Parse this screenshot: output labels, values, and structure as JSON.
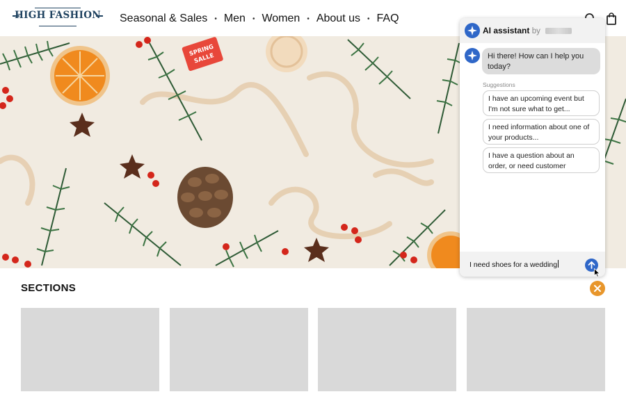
{
  "brand": {
    "logo_text": "HIGH FASHION"
  },
  "nav": {
    "items": [
      {
        "label": "Seasonal & Sales"
      },
      {
        "label": "Men"
      },
      {
        "label": "Women"
      },
      {
        "label": "About us"
      },
      {
        "label": "FAQ"
      }
    ],
    "separator": "•"
  },
  "header_icons": [
    "search-icon",
    "shopping-bag-icon"
  ],
  "hero": {
    "tag_text": "SPRING SALLE"
  },
  "sections": {
    "title": "SECTIONS",
    "card_count": 4
  },
  "chat": {
    "title": "AI assistant",
    "title_by": "by",
    "bot_message": "Hi there! How can I help you today?",
    "suggestions_label": "Suggestions",
    "suggestions": [
      {
        "text": "I have an upcoming event but I'm not sure what to get..."
      },
      {
        "text": "I need information about one of your products..."
      },
      {
        "text": "I have a question about an order, or need customer service..."
      }
    ],
    "input_value": "I need shoes for a wedding"
  },
  "colors": {
    "brand_navy": "#1f4260",
    "accent_blue": "#2f67c8",
    "close_orange": "#e8962b",
    "placeholder_gray": "#d9d9d9"
  }
}
